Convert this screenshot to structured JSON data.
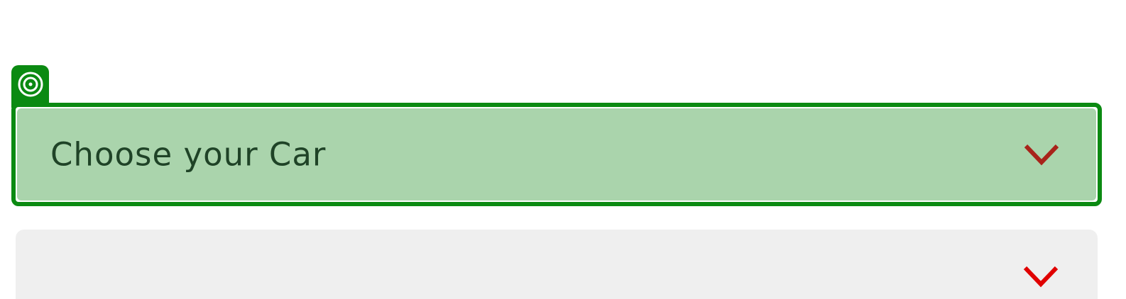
{
  "focus_indicator": {
    "icon": "target-icon",
    "color": "#0b8a12"
  },
  "selects": [
    {
      "label": "Choose your Car",
      "icon": "chevron-down-icon",
      "state": "focused",
      "background": "#aad4ac",
      "border_color": "#0b8a12",
      "chevron_color": "#a8231a"
    },
    {
      "label": "",
      "icon": "chevron-down-icon",
      "state": "default",
      "background": "#efefef",
      "chevron_color": "#e00000"
    }
  ]
}
